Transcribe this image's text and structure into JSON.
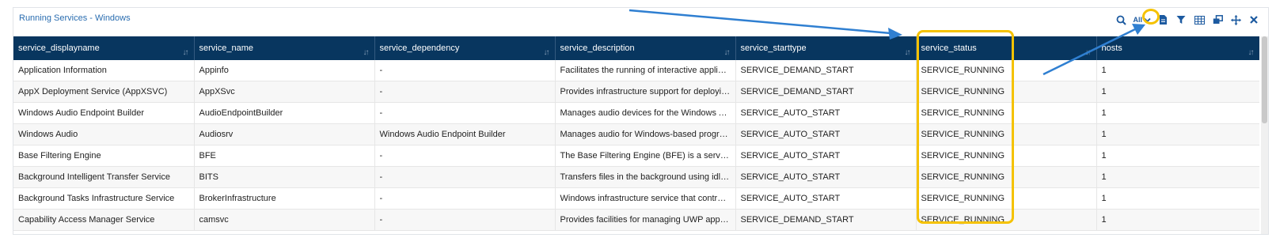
{
  "panel": {
    "title": "Running Services - Windows"
  },
  "toolbar": {
    "time_range": "All",
    "icons": [
      "search-icon",
      "chevron-down-icon",
      "document-icon",
      "filter-icon",
      "table-icon",
      "window-icon",
      "move-icon",
      "close-icon"
    ]
  },
  "table": {
    "columns": [
      "service_displayname",
      "service_name",
      "service_dependency",
      "service_description",
      "service_starttype",
      "service_status",
      "hosts"
    ],
    "rows": [
      [
        "Application Information",
        "Appinfo",
        "-",
        "Facilitates the running of interactive applications...",
        "SERVICE_DEMAND_START",
        "SERVICE_RUNNING",
        "1"
      ],
      [
        "AppX Deployment Service (AppXSVC)",
        "AppXSvc",
        "-",
        "Provides infrastructure support for deploying Sto...",
        "SERVICE_DEMAND_START",
        "SERVICE_RUNNING",
        "1"
      ],
      [
        "Windows Audio Endpoint Builder",
        "AudioEndpointBuilder",
        "-",
        "Manages audio devices for the Windows Audio se...",
        "SERVICE_AUTO_START",
        "SERVICE_RUNNING",
        "1"
      ],
      [
        "Windows Audio",
        "Audiosrv",
        "Windows Audio Endpoint Builder",
        "Manages audio for Windows-based programs. If t...",
        "SERVICE_AUTO_START",
        "SERVICE_RUNNING",
        "1"
      ],
      [
        "Base Filtering Engine",
        "BFE",
        "-",
        "The Base Filtering Engine (BFE) is a service that ...",
        "SERVICE_AUTO_START",
        "SERVICE_RUNNING",
        "1"
      ],
      [
        "Background Intelligent Transfer Service",
        "BITS",
        "-",
        "Transfers files in the background using idle netw...",
        "SERVICE_AUTO_START",
        "SERVICE_RUNNING",
        "1"
      ],
      [
        "Background Tasks Infrastructure Service",
        "BrokerInfrastructure",
        "-",
        "Windows infrastructure service that controls whi...",
        "SERVICE_AUTO_START",
        "SERVICE_RUNNING",
        "1"
      ],
      [
        "Capability Access Manager Service",
        "camsvc",
        "-",
        "Provides facilities for managing UWP apps access...",
        "SERVICE_DEMAND_START",
        "SERVICE_RUNNING",
        "1"
      ]
    ]
  },
  "colors": {
    "header_bg": "#08365f",
    "title": "#2a6db0",
    "highlight": "#f5c200",
    "arrow": "#2f7fd1"
  }
}
